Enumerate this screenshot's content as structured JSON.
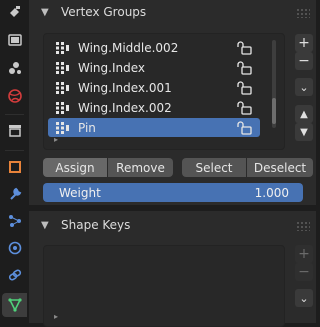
{
  "tabs": [
    {
      "name": "tool-icon",
      "active": false
    },
    {
      "name": "render-icon",
      "active": false
    },
    {
      "name": "output-icon",
      "active": false
    },
    {
      "name": "view-layer-icon",
      "active": false
    },
    {
      "name": "scene-icon",
      "active": false
    },
    {
      "name": "world-icon",
      "active": false
    },
    {
      "name": "collection-icon",
      "active": false
    },
    {
      "name": "object-icon",
      "active": false
    },
    {
      "name": "modifier-icon",
      "active": false
    },
    {
      "name": "particles-icon",
      "active": false
    },
    {
      "name": "physics-icon",
      "active": false
    },
    {
      "name": "constraints-icon",
      "active": false
    },
    {
      "name": "data-mesh-icon",
      "active": true
    }
  ],
  "vertex_groups": {
    "title": "Vertex Groups",
    "items": [
      {
        "label": "Wing.Middle.002",
        "selected": false
      },
      {
        "label": "Wing.Index",
        "selected": false
      },
      {
        "label": "Wing.Index.001",
        "selected": false
      },
      {
        "label": "Wing.Index.002",
        "selected": false
      },
      {
        "label": "Pin",
        "selected": true
      }
    ],
    "add_label": "+",
    "remove_label": "−",
    "menu_label": "⌄",
    "move_up_label": "▲",
    "move_down_label": "▼",
    "assign_label": "Assign",
    "remove_btn_label": "Remove",
    "select_label": "Select",
    "deselect_label": "Deselect",
    "weight_label": "Weight",
    "weight_value": "1.000"
  },
  "shape_keys": {
    "title": "Shape Keys",
    "add_label": "+",
    "remove_label": "−",
    "menu_label": "⌄"
  }
}
